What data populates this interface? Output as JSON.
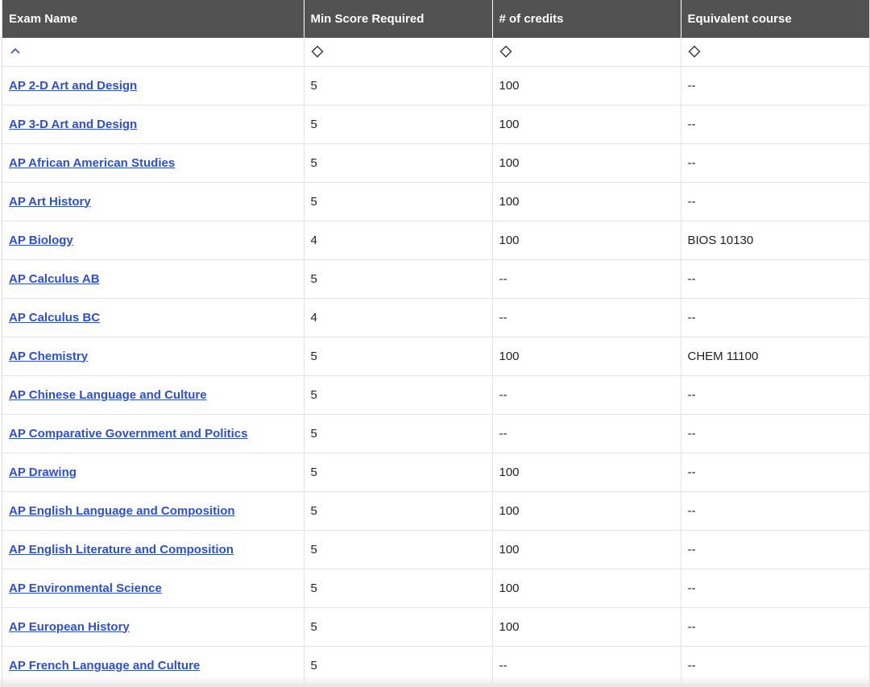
{
  "table": {
    "headers": [
      "Exam Name",
      "Min Score Required",
      "# of credits",
      "Equivalent course"
    ],
    "sort_icons": [
      "chevron-up-icon",
      "sort-icon",
      "sort-icon",
      "sort-icon"
    ],
    "accent_color": "#2c4fd6",
    "header_bg": "#525252",
    "rows": [
      {
        "exam": "AP 2-D Art and Design",
        "score": "5",
        "credits": "100",
        "course": "--"
      },
      {
        "exam": "AP 3-D Art and Design",
        "score": "5",
        "credits": "100",
        "course": "--"
      },
      {
        "exam": "AP African American Studies",
        "score": "5",
        "credits": "100",
        "course": "--"
      },
      {
        "exam": "AP Art History",
        "score": "5",
        "credits": "100",
        "course": "--"
      },
      {
        "exam": "AP Biology",
        "score": "4",
        "credits": "100",
        "course": "BIOS 10130"
      },
      {
        "exam": "AP Calculus AB",
        "score": "5",
        "credits": "--",
        "course": "--"
      },
      {
        "exam": "AP Calculus BC",
        "score": "4",
        "credits": "--",
        "course": "--"
      },
      {
        "exam": "AP Chemistry",
        "score": "5",
        "credits": "100",
        "course": "CHEM 11100"
      },
      {
        "exam": "AP Chinese Language and Culture",
        "score": "5",
        "credits": "--",
        "course": "--"
      },
      {
        "exam": "AP Comparative Government and Politics",
        "score": "5",
        "credits": "--",
        "course": "--"
      },
      {
        "exam": "AP Drawing",
        "score": "5",
        "credits": "100",
        "course": "--"
      },
      {
        "exam": "AP English Language and Composition",
        "score": "5",
        "credits": "100",
        "course": "--"
      },
      {
        "exam": "AP English Literature and Composition",
        "score": "5",
        "credits": "100",
        "course": "--"
      },
      {
        "exam": "AP Environmental Science",
        "score": "5",
        "credits": "100",
        "course": "--"
      },
      {
        "exam": "AP European History",
        "score": "5",
        "credits": "100",
        "course": "--"
      },
      {
        "exam": "AP French Language and Culture",
        "score": "5",
        "credits": "--",
        "course": "--"
      }
    ]
  }
}
